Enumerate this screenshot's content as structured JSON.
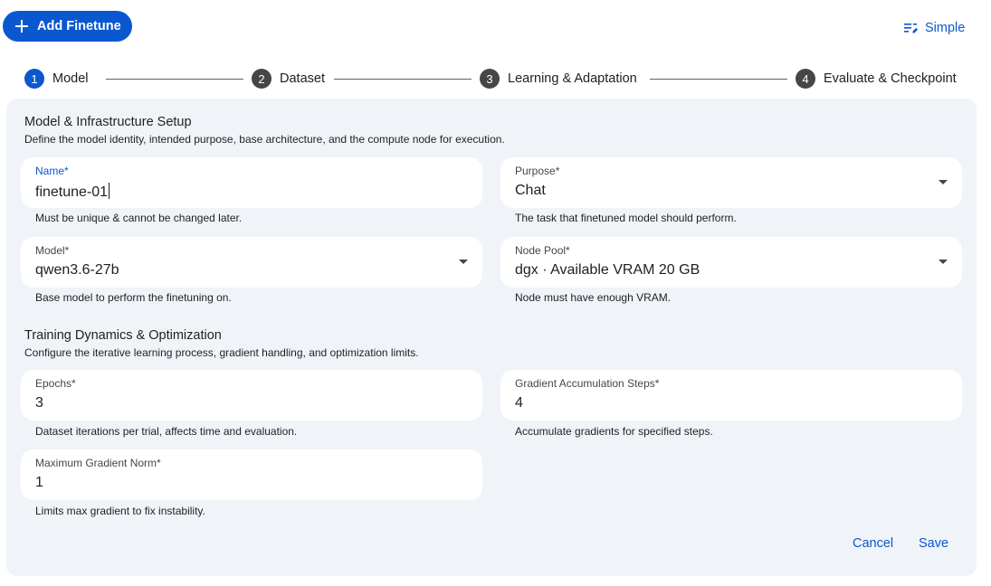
{
  "header": {
    "add_button_label": "Add Finetune",
    "simple_label": "Simple"
  },
  "stepper": {
    "steps": [
      {
        "number": "1",
        "label": "Model"
      },
      {
        "number": "2",
        "label": "Dataset"
      },
      {
        "number": "3",
        "label": "Learning & Adaptation"
      },
      {
        "number": "4",
        "label": "Evaluate & Checkpoint"
      }
    ],
    "active_step": "1"
  },
  "sections": {
    "model_setup": {
      "title": "Model & Infrastructure Setup",
      "description": "Define the model identity, intended purpose, base architecture, and the compute node for execution."
    },
    "training": {
      "title": "Training Dynamics & Optimization",
      "description": "Configure the iterative learning process, gradient handling, and optimization limits."
    }
  },
  "fields": {
    "name": {
      "label": "Name*",
      "value": "finetune-01",
      "helper": "Must be unique & cannot be changed later."
    },
    "purpose": {
      "label": "Purpose*",
      "value": "Chat",
      "helper": "The task that finetuned model should perform."
    },
    "model": {
      "label": "Model*",
      "value": "qwen3.6-27b",
      "helper": "Base model to perform the finetuning on."
    },
    "node_pool": {
      "label": "Node Pool*",
      "value": "dgx · Available VRAM 20 GB",
      "helper": "Node must have enough VRAM."
    },
    "epochs": {
      "label": "Epochs*",
      "value": "3",
      "helper": "Dataset iterations per trial, affects time and evaluation."
    },
    "grad_accum": {
      "label": "Gradient Accumulation Steps*",
      "value": "4",
      "helper": "Accumulate gradients for specified steps."
    },
    "max_grad_norm": {
      "label": "Maximum Gradient Norm*",
      "value": "1",
      "helper": "Limits max gradient to fix instability."
    }
  },
  "actions": {
    "cancel_label": "Cancel",
    "save_label": "Save"
  },
  "colors": {
    "primary": "#0b57d0",
    "panel_bg": "#f0f4f9",
    "step_inactive": "#444746"
  },
  "icons": {
    "add": "plus-icon",
    "simple": "list-edit-icon",
    "dropdown": "caret-down-icon"
  }
}
